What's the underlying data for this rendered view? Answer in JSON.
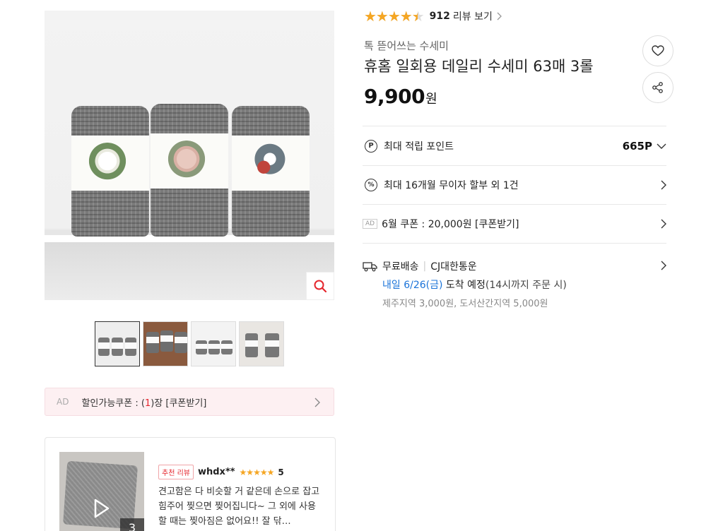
{
  "gallery": {
    "thumbnail_count": 4,
    "active_thumbnail": 0
  },
  "coupon_bar": {
    "ad_label": "AD",
    "text_prefix": "할인가능쿠폰 : (",
    "count": "1",
    "text_suffix": ")장 [쿠폰받기]"
  },
  "review_card": {
    "media_count": "3",
    "badge": "추천 리뷰",
    "reviewer": "whdx**",
    "stars": "★★★★★",
    "score": "5",
    "text": "견고함은 다 비슷할 거 같은데 손으로 잡고 힘주어 찢으면 찢어집니다~ 그 외에 사용할 때는 찢아짐은 없어요!! 잘 닦…"
  },
  "product": {
    "rating_value": 4.5,
    "stars_glyph": "★★★★★",
    "review_count": "912",
    "review_link": "리뷰 보기",
    "brand": "톡 뜯어쓰는 수세미",
    "title": "휴홈 일회용 데일리 수세미 63매 3롤",
    "price": "9,900",
    "price_unit": "원"
  },
  "benefits": {
    "points_label": "최대 적립 포인트",
    "points_value": "665P",
    "installment_label": "최대 16개월 무이자 할부 외 1건",
    "coupon_ad": "AD",
    "coupon_label": "6월 쿠폰 : 20,000원 [쿠폰받기]",
    "point_icon": "P",
    "installment_icon": "%"
  },
  "shipping": {
    "fee_label": "무료배송",
    "carrier": "CJ대한통운",
    "arrival_date": "내일 6/26(금)",
    "arrival_text": " 도착 예정",
    "cutoff": "(14시까지 주문 시)",
    "regional_fees": "제주지역 3,000원, 도서산간지역 5,000원"
  },
  "colors": {
    "accent_red": "#e5262d",
    "star": "#f5a623",
    "link_blue": "#1a73d9"
  }
}
